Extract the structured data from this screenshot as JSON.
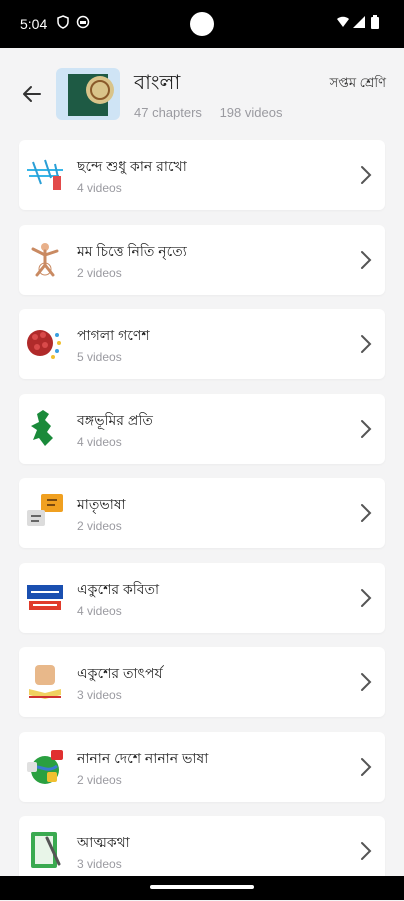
{
  "status": {
    "time": "5:04"
  },
  "book": {
    "title": "বাংলা",
    "chapters": "47 chapters",
    "videos": "198 videos",
    "grade": "সপ্তম শ্রেণি"
  },
  "chapters": [
    {
      "title": "ছন্দে শুধু কান রাখো",
      "count": "4 videos",
      "icon": "rhythm-sketch-icon"
    },
    {
      "title": "মম চিত্তে নিতি নৃত্যে",
      "count": "2 videos",
      "icon": "dancer-icon"
    },
    {
      "title": "পাগলা গণেশ",
      "count": "5 videos",
      "icon": "brain-icon"
    },
    {
      "title": "বঙ্গভূমির প্রতি",
      "count": "4 videos",
      "icon": "map-icon"
    },
    {
      "title": "মাতৃভাষা",
      "count": "2 videos",
      "icon": "language-icon"
    },
    {
      "title": "একুশের কবিতা",
      "count": "4 videos",
      "icon": "ekushe-icon"
    },
    {
      "title": "একুশের তাৎপর্য",
      "count": "3 videos",
      "icon": "fist-book-icon"
    },
    {
      "title": "নানান দেশে নানান ভাষা",
      "count": "2 videos",
      "icon": "globe-language-icon"
    },
    {
      "title": "আত্মকথা",
      "count": "3 videos",
      "icon": "notebook-pen-icon"
    }
  ],
  "colors": {
    "background": "#f4f4f5",
    "card": "#ffffff",
    "muted": "#9a9aa0"
  }
}
